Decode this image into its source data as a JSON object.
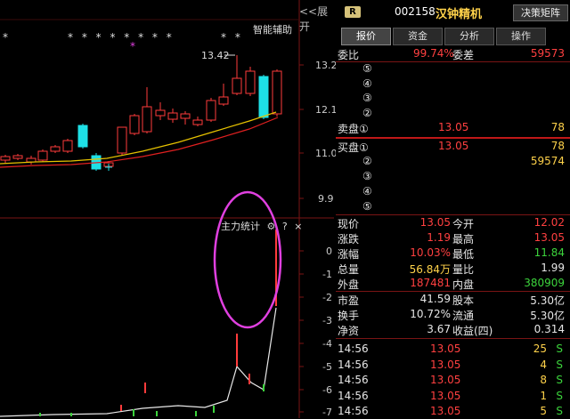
{
  "chart": {
    "expand_label": "<<展开",
    "smart_assist": "智能辅助",
    "star_groups": [
      "*",
      "* * * * * * * *",
      "* *"
    ],
    "magenta_star": "*",
    "high_label": "13.42",
    "price_ticks": [
      "13.2",
      "12.1",
      "11.0",
      "9.9"
    ],
    "indicator_ticks": [
      "0",
      "-1",
      "-2",
      "-3",
      "-4",
      "-5",
      "-6",
      "-7"
    ],
    "stat_title": "主力统计",
    "stat_gear": "⚙",
    "stat_help": "?",
    "stat_close": "×",
    "colors": {
      "up": "#ff3b3b",
      "down": "#1ee0e6",
      "ma_short": "#e6c200",
      "ma_long": "#e02020",
      "highlight": "#e040e0"
    }
  },
  "chart_data": {
    "type": "candlestick",
    "price_axis_ticks": [
      13.2,
      12.1,
      11.0,
      9.9
    ],
    "high_annotation": 13.42,
    "indicator_axis_ticks": [
      0,
      -1,
      -2,
      -3,
      -4,
      -5,
      -6,
      -7
    ]
  },
  "quote": {
    "badge": "R",
    "code": "002158",
    "name": "汉钟精机",
    "decision_button": "决策矩阵",
    "tabs": [
      "报价",
      "资金",
      "分析",
      "操作"
    ],
    "weibi_label": "委比",
    "weibi_value": "99.74%",
    "weicha_label": "委差",
    "weicha_value": "59573",
    "sell_levels": [
      {
        "label": "⑤",
        "price": "",
        "volume": ""
      },
      {
        "label": "④",
        "price": "",
        "volume": ""
      },
      {
        "label": "③",
        "price": "",
        "volume": ""
      },
      {
        "label": "②",
        "price": "",
        "volume": ""
      },
      {
        "label": "卖盘①",
        "price": "13.05",
        "volume": "78"
      }
    ],
    "buy_levels": [
      {
        "label": "买盘①",
        "price": "13.05",
        "volume": "78"
      },
      {
        "label": "②",
        "price": "",
        "volume": "59574"
      },
      {
        "label": "③",
        "price": "",
        "volume": ""
      },
      {
        "label": "④",
        "price": "",
        "volume": ""
      },
      {
        "label": "⑤",
        "price": "",
        "volume": ""
      }
    ],
    "stats": [
      {
        "l1": "现价",
        "v1": "13.05",
        "c1": "red",
        "l2": "今开",
        "v2": "12.02",
        "c2": "red"
      },
      {
        "l1": "涨跌",
        "v1": "1.19",
        "c1": "red",
        "l2": "最高",
        "v2": "13.05",
        "c2": "red"
      },
      {
        "l1": "涨幅",
        "v1": "10.03%",
        "c1": "red",
        "l2": "最低",
        "v2": "11.84",
        "c2": "green"
      },
      {
        "l1": "总量",
        "v1": "56.84万",
        "c1": "yellow",
        "l2": "量比",
        "v2": "1.99",
        "c2": "white"
      },
      {
        "l1": "外盘",
        "v1": "187481",
        "c1": "red",
        "l2": "内盘",
        "v2": "380909",
        "c2": "green"
      }
    ],
    "fundamentals": [
      {
        "l1": "市盈",
        "v1": "41.59",
        "l2": "股本",
        "v2": "5.30亿"
      },
      {
        "l1": "换手",
        "v1": "10.72%",
        "l2": "流通",
        "v2": "5.30亿"
      },
      {
        "l1": "净资",
        "v1": "3.67",
        "l2": "收益(四)",
        "v2": "0.314"
      }
    ],
    "ticks": [
      {
        "time": "14:56",
        "price": "13.05",
        "vol": "25",
        "flag": "S"
      },
      {
        "time": "14:56",
        "price": "13.05",
        "vol": "4",
        "flag": "S"
      },
      {
        "time": "14:56",
        "price": "13.05",
        "vol": "8",
        "flag": "S"
      },
      {
        "time": "14:56",
        "price": "13.05",
        "vol": "1",
        "flag": "S"
      },
      {
        "time": "14:56",
        "price": "13.05",
        "vol": "5",
        "flag": "S"
      }
    ]
  }
}
